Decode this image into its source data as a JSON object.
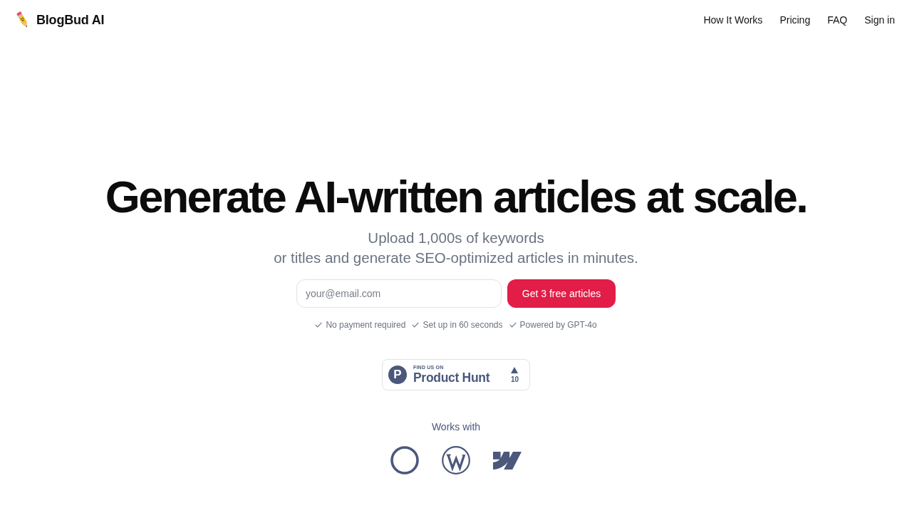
{
  "header": {
    "logo_text": "BlogBud AI",
    "nav": [
      {
        "label": "How It Works"
      },
      {
        "label": "Pricing"
      },
      {
        "label": "FAQ"
      },
      {
        "label": "Sign in"
      }
    ]
  },
  "hero": {
    "headline": "Generate AI-written articles at scale.",
    "subtitle_lines": [
      "Upload 1,000s of keywords",
      "or titles and generate SEO-optimized articles in minutes."
    ],
    "email_field": {
      "placeholder": "your@email.com"
    },
    "cta_button": "Get 3 free articles",
    "checks": [
      "No payment required",
      "Set up in 60 seconds",
      "Powered by GPT-4o"
    ]
  },
  "product_hunt_badge": {
    "logo_letter": "P",
    "eyebrow": "FIND US ON",
    "name": "Product Hunt",
    "upvotes": "10"
  },
  "integrations": {
    "heading": "Works with"
  }
}
